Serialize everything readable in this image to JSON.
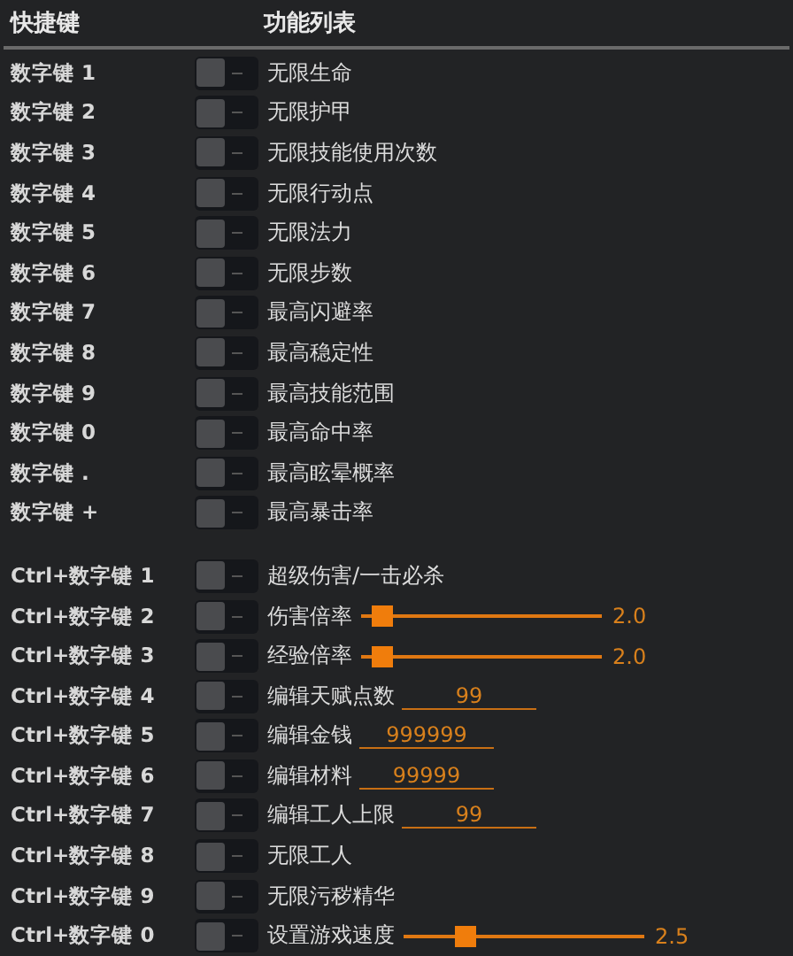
{
  "header": {
    "key_column": "快捷键",
    "function_column": "功能列表"
  },
  "groups": [
    {
      "rows": [
        {
          "key": "数字键 1",
          "kind": "toggle",
          "on": false,
          "label": "无限生命"
        },
        {
          "key": "数字键 2",
          "kind": "toggle",
          "on": false,
          "label": "无限护甲"
        },
        {
          "key": "数字键 3",
          "kind": "toggle",
          "on": false,
          "label": "无限技能使用次数"
        },
        {
          "key": "数字键 4",
          "kind": "toggle",
          "on": false,
          "label": "无限行动点"
        },
        {
          "key": "数字键 5",
          "kind": "toggle",
          "on": false,
          "label": "无限法力"
        },
        {
          "key": "数字键 6",
          "kind": "toggle",
          "on": false,
          "label": "无限步数"
        },
        {
          "key": "数字键 7",
          "kind": "toggle",
          "on": false,
          "label": "最高闪避率"
        },
        {
          "key": "数字键 8",
          "kind": "toggle",
          "on": false,
          "label": "最高稳定性"
        },
        {
          "key": "数字键 9",
          "kind": "toggle",
          "on": false,
          "label": "最高技能范围"
        },
        {
          "key": "数字键 0",
          "kind": "toggle",
          "on": false,
          "label": "最高命中率"
        },
        {
          "key": "数字键 .",
          "kind": "toggle",
          "on": false,
          "label": "最高眩晕概率"
        },
        {
          "key": "数字键 +",
          "kind": "toggle",
          "on": false,
          "label": "最高暴击率"
        }
      ]
    },
    {
      "rows": [
        {
          "key": "Ctrl+数字键 1",
          "kind": "toggle",
          "on": false,
          "label": "超级伤害/一击必杀"
        },
        {
          "key": "Ctrl+数字键 2",
          "kind": "slider",
          "on": false,
          "label": "伤害倍率",
          "level": 0.09,
          "reading": "2.0"
        },
        {
          "key": "Ctrl+数字键 3",
          "kind": "slider",
          "on": false,
          "label": "经验倍率",
          "level": 0.09,
          "reading": "2.0"
        },
        {
          "key": "Ctrl+数字键 4",
          "kind": "input",
          "on": false,
          "label": "编辑天赋点数",
          "value": "99"
        },
        {
          "key": "Ctrl+数字键 5",
          "kind": "input",
          "on": false,
          "label": "编辑金钱",
          "value": "999999"
        },
        {
          "key": "Ctrl+数字键 6",
          "kind": "input",
          "on": false,
          "label": "编辑材料",
          "value": "99999"
        },
        {
          "key": "Ctrl+数字键 7",
          "kind": "input",
          "on": false,
          "label": "编辑工人上限",
          "value": "99"
        },
        {
          "key": "Ctrl+数字键 8",
          "kind": "toggle",
          "on": false,
          "label": "无限工人"
        },
        {
          "key": "Ctrl+数字键 9",
          "kind": "toggle",
          "on": false,
          "label": "无限污秽精华"
        },
        {
          "key": "Ctrl+数字键 0",
          "kind": "slider",
          "on": false,
          "label": "设置游戏速度",
          "level": 0.26,
          "reading": "2.5"
        }
      ]
    }
  ]
}
